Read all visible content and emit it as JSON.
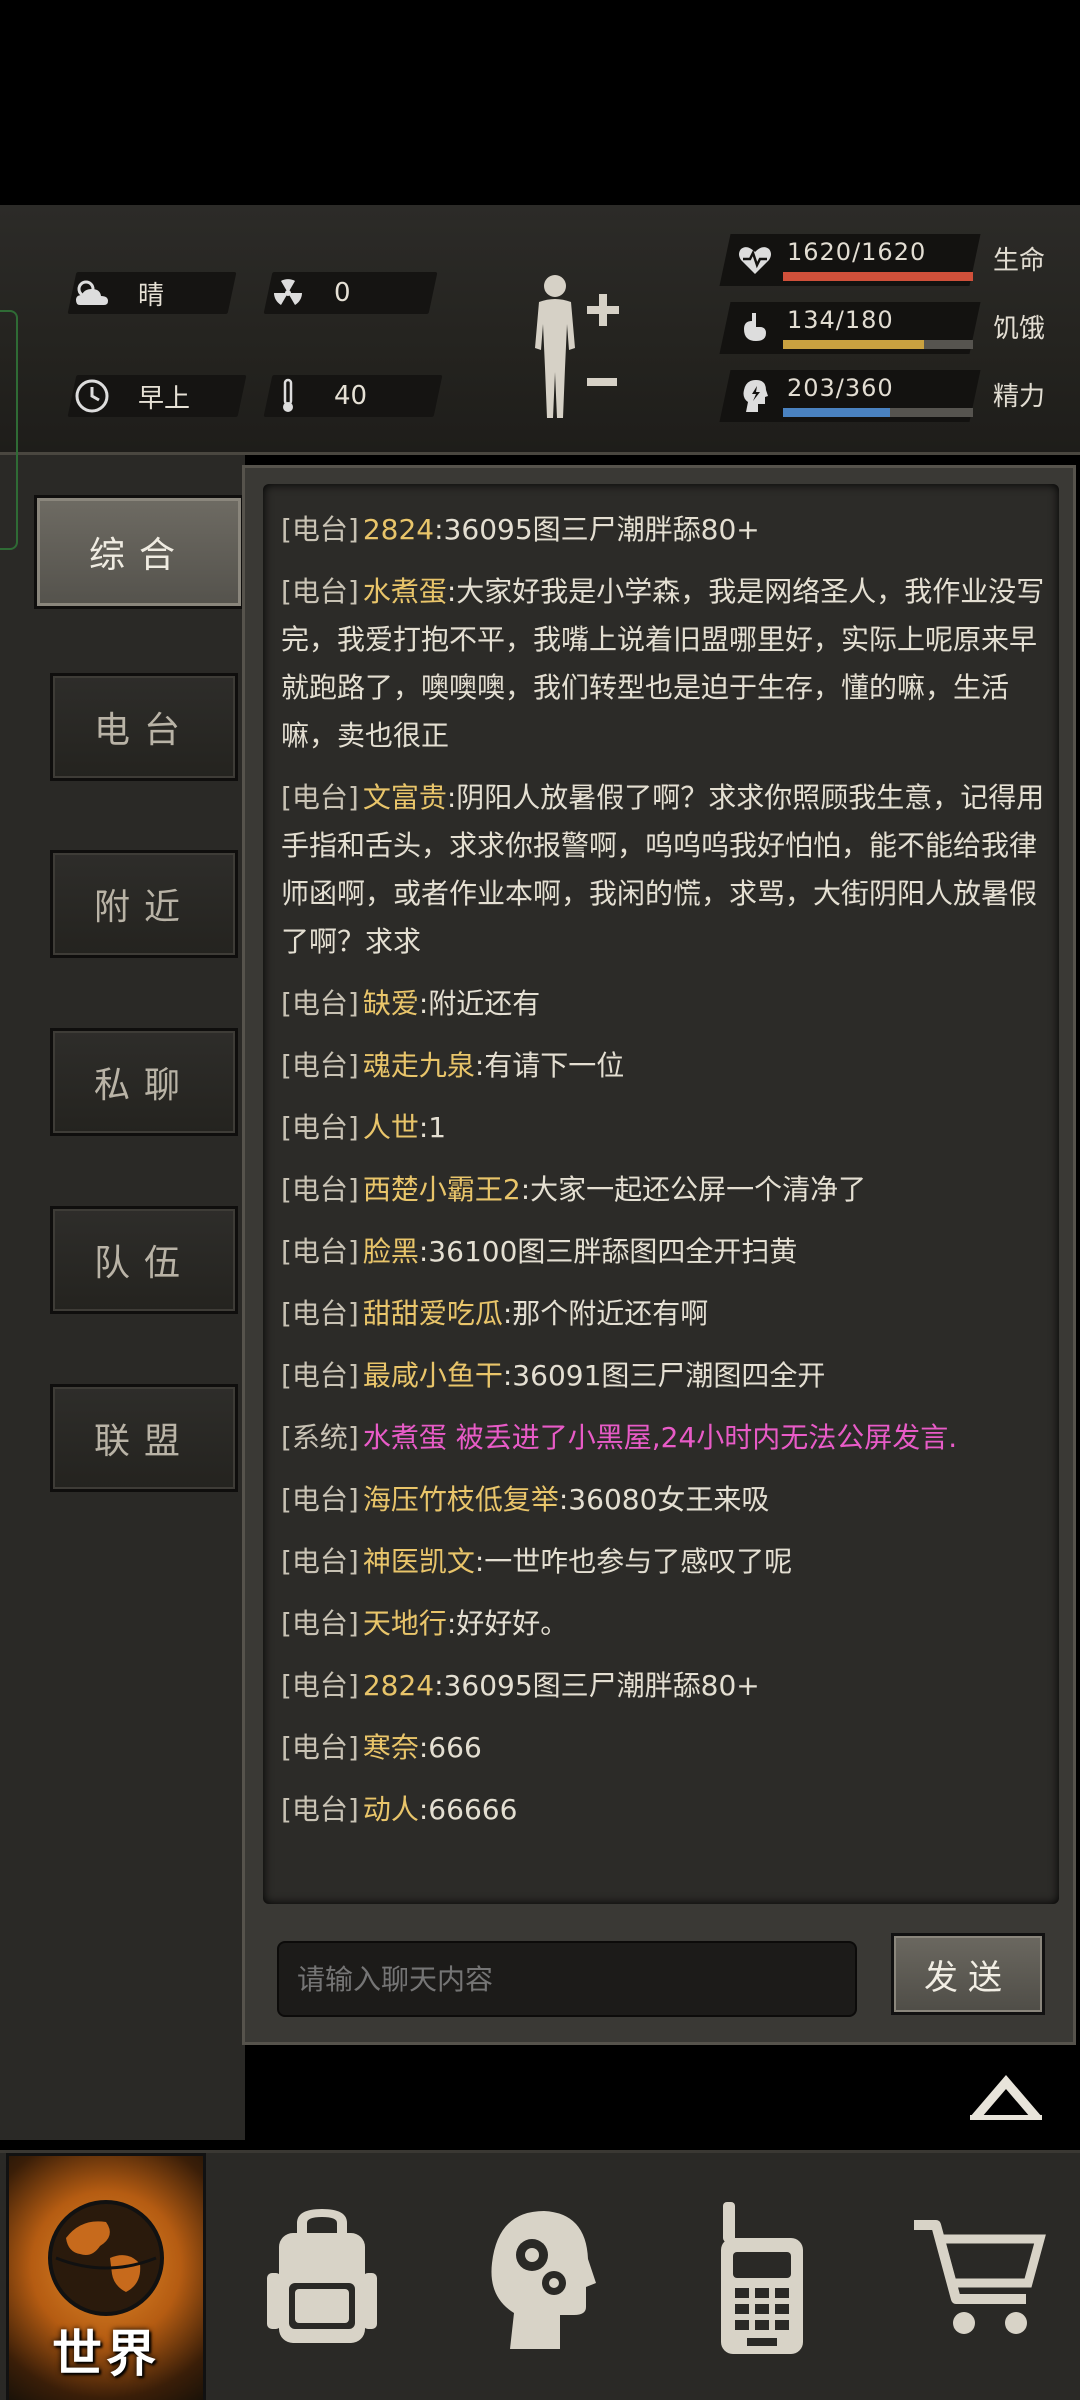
{
  "status": {
    "weather_label": "晴",
    "radiation_value": "0",
    "time_of_day": "早上",
    "temperature_value": "40"
  },
  "vitals": {
    "health": {
      "value_text": "1620/1620",
      "label": "生命",
      "fraction": 1.0,
      "color": "#d0503a"
    },
    "hunger": {
      "value_text": "134/180",
      "label": "饥饿",
      "fraction": 0.744,
      "color": "#c9a140"
    },
    "energy": {
      "value_text": "203/360",
      "label": "精力",
      "fraction": 0.564,
      "color": "#4a82c0"
    }
  },
  "tabs": [
    {
      "label": "综合",
      "active": true
    },
    {
      "label": "电台",
      "active": false
    },
    {
      "label": "附近",
      "active": false
    },
    {
      "label": "私聊",
      "active": false
    },
    {
      "label": "队伍",
      "active": false
    },
    {
      "label": "联盟",
      "active": false
    }
  ],
  "messages": [
    {
      "channel": "[电台]",
      "nick": "2824",
      "text": ":36095图三尸潮胖舔80+"
    },
    {
      "channel": "[电台]",
      "nick": "水煮蛋",
      "text": ":大家好我是小学森，我是网络圣人，我作业没写完，我爱打抱不平，我嘴上说着旧盟哪里好，实际上呢原来早就跑路了，噢噢噢，我们转型也是迫于生存，懂的嘛，生活嘛，卖也很正"
    },
    {
      "channel": "[电台]",
      "nick": "文富贵",
      "text": ":阴阳人放暑假了啊？求求你照顾我生意，记得用手指和舌头，求求你报警啊，呜呜呜我好怕怕，能不能给我律师函啊，或者作业本啊，我闲的慌，求骂，大街阴阳人放暑假了啊？求求"
    },
    {
      "channel": "[电台]",
      "nick": "缺爱",
      "text": ":附近还有"
    },
    {
      "channel": "[电台]",
      "nick": "魂走九泉",
      "text": ":有请下一位"
    },
    {
      "channel": "[电台]",
      "nick": "人世",
      "text": ":1"
    },
    {
      "channel": "[电台]",
      "nick": "西楚小霸王2",
      "text": ":大家一起还公屏一个清净了"
    },
    {
      "channel": "[电台]",
      "nick": "脸黑",
      "text": ":36100图三胖舔图四全开扫黄"
    },
    {
      "channel": "[电台]",
      "nick": "甜甜爱吃瓜",
      "text": ":那个附近还有啊"
    },
    {
      "channel": "[电台]",
      "nick": "最咸小鱼干",
      "text": ":36091图三尸潮图四全开"
    },
    {
      "channel": "[系统]",
      "nick": "水煮蛋",
      "text": " 被丢进了小黑屋,24小时内无法公屏发言.",
      "system": true
    },
    {
      "channel": "[电台]",
      "nick": "海压竹枝低复举",
      "text": ":36080女王来吸"
    },
    {
      "channel": "[电台]",
      "nick": "神医凯文",
      "text": ":一世咋也参与了感叹了呢"
    },
    {
      "channel": "[电台]",
      "nick": "天地行",
      "text": ":好好好。"
    },
    {
      "channel": "[电台]",
      "nick": "2824",
      "text": ":36095图三尸潮胖舔80+"
    },
    {
      "channel": "[电台]",
      "nick": "寒奈",
      "text": ":666"
    },
    {
      "channel": "[电台]",
      "nick": "动人",
      "text": ":66666"
    }
  ],
  "chat_input": {
    "placeholder": "请输入聊天内容"
  },
  "send_label": "发送",
  "bottom_nav": {
    "world_label": "世界",
    "items": [
      "globe-icon",
      "backpack-icon",
      "head-gears-icon",
      "walkie-talkie-icon",
      "cart-icon"
    ]
  }
}
